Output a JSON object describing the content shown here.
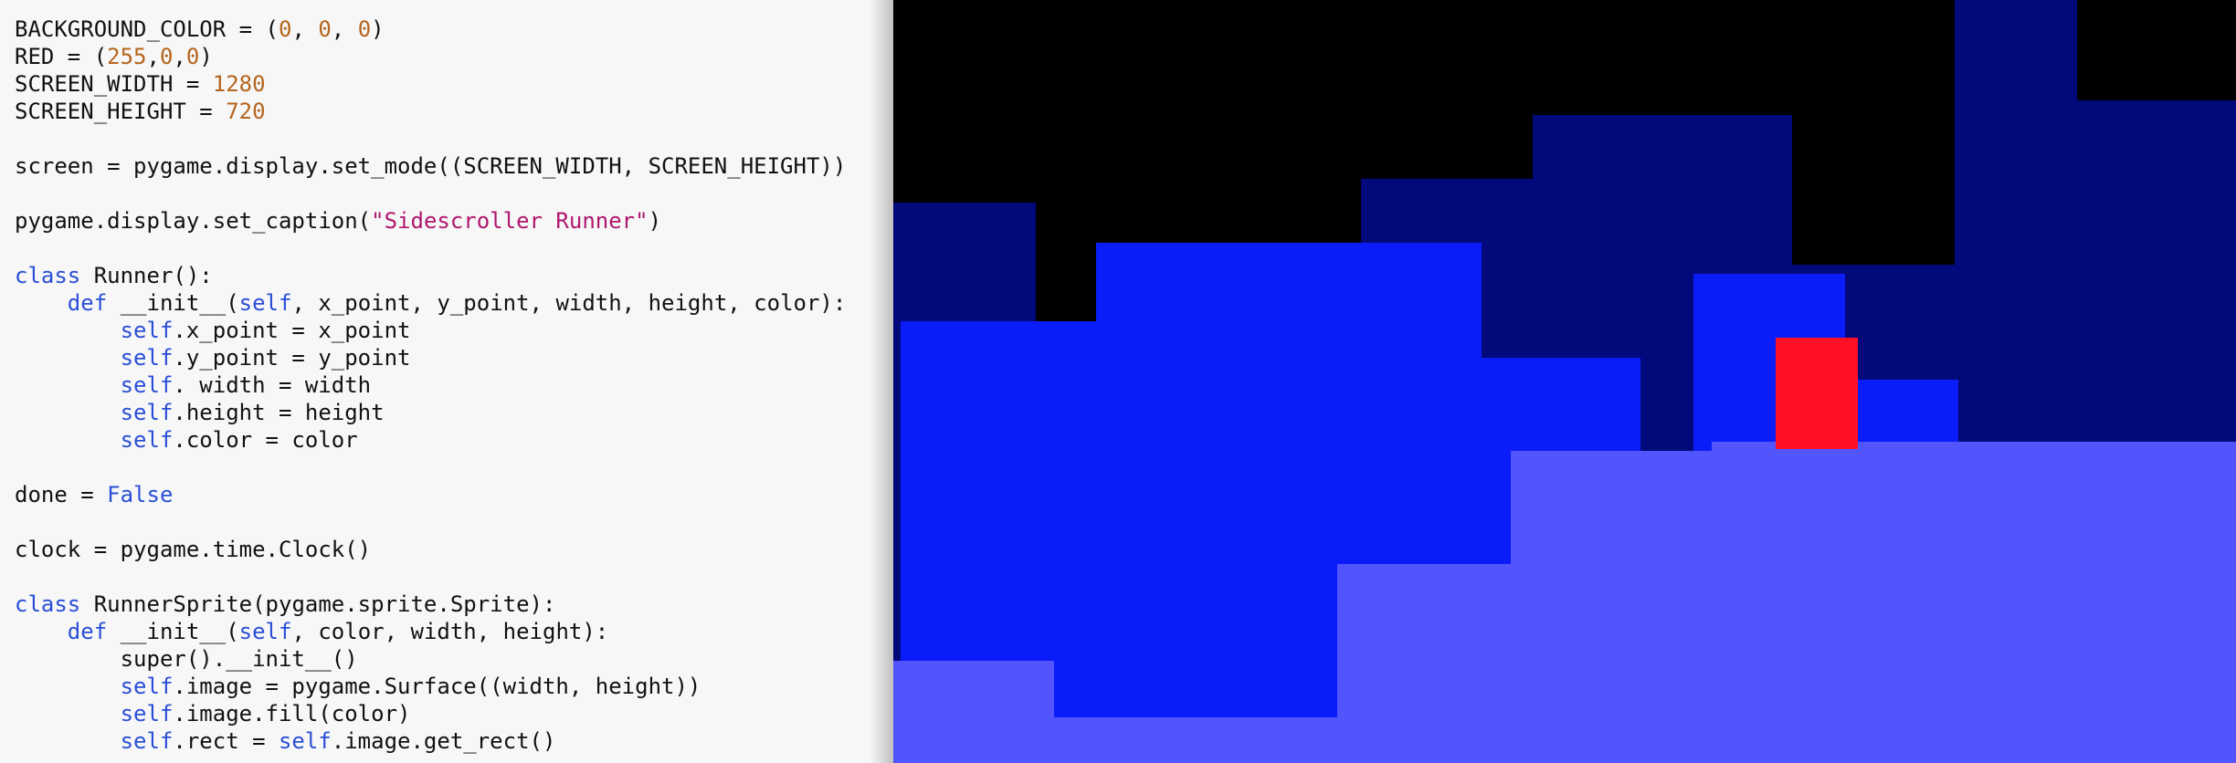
{
  "editor": {
    "lines": [
      [
        {
          "t": "BACKGROUND_COLOR = ("
        },
        {
          "t": "0",
          "c": "num"
        },
        {
          "t": ", "
        },
        {
          "t": "0",
          "c": "num"
        },
        {
          "t": ", "
        },
        {
          "t": "0",
          "c": "num"
        },
        {
          "t": ")"
        }
      ],
      [
        {
          "t": "RED = ("
        },
        {
          "t": "255",
          "c": "num"
        },
        {
          "t": ","
        },
        {
          "t": "0",
          "c": "num"
        },
        {
          "t": ","
        },
        {
          "t": "0",
          "c": "num"
        },
        {
          "t": ")"
        }
      ],
      [
        {
          "t": "SCREEN_WIDTH = "
        },
        {
          "t": "1280",
          "c": "num"
        }
      ],
      [
        {
          "t": "SCREEN_HEIGHT = "
        },
        {
          "t": "720",
          "c": "num"
        }
      ],
      [],
      [
        {
          "t": "screen = pygame.display.set_mode((SCREEN_WIDTH, SCREEN_HEIGHT))"
        }
      ],
      [],
      [
        {
          "t": "pygame.display.set_caption("
        },
        {
          "t": "\"Sidescroller Runner\"",
          "c": "str"
        },
        {
          "t": ")"
        }
      ],
      [],
      [
        {
          "t": "class",
          "c": "kw"
        },
        {
          "t": " Runner():"
        }
      ],
      [
        {
          "t": "    "
        },
        {
          "t": "def",
          "c": "kw"
        },
        {
          "t": " __init__("
        },
        {
          "t": "self",
          "c": "kw"
        },
        {
          "t": ", x_point, y_point, width, height, color):"
        }
      ],
      [
        {
          "t": "        "
        },
        {
          "t": "self",
          "c": "kw"
        },
        {
          "t": ".x_point = x_point"
        }
      ],
      [
        {
          "t": "        "
        },
        {
          "t": "self",
          "c": "kw"
        },
        {
          "t": ".y_point = y_point"
        }
      ],
      [
        {
          "t": "        "
        },
        {
          "t": "self",
          "c": "kw"
        },
        {
          "t": ". width = width"
        }
      ],
      [
        {
          "t": "        "
        },
        {
          "t": "self",
          "c": "kw"
        },
        {
          "t": ".height = height"
        }
      ],
      [
        {
          "t": "        "
        },
        {
          "t": "self",
          "c": "kw"
        },
        {
          "t": ".color = color"
        }
      ],
      [],
      [
        {
          "t": "done = "
        },
        {
          "t": "False",
          "c": "kw"
        }
      ],
      [],
      [
        {
          "t": "clock = pygame.time.Clock()"
        }
      ],
      [],
      [
        {
          "t": "class",
          "c": "kw"
        },
        {
          "t": " RunnerSprite(pygame.sprite.Sprite):"
        }
      ],
      [
        {
          "t": "    "
        },
        {
          "t": "def",
          "c": "kw"
        },
        {
          "t": " __init__("
        },
        {
          "t": "self",
          "c": "kw"
        },
        {
          "t": ", color, width, height):"
        }
      ],
      [
        {
          "t": "        super().__init__()"
        }
      ],
      [
        {
          "t": "        "
        },
        {
          "t": "self",
          "c": "kw"
        },
        {
          "t": ".image = pygame.Surface((width, height))"
        }
      ],
      [
        {
          "t": "        "
        },
        {
          "t": "self",
          "c": "kw"
        },
        {
          "t": ".image.fill(color)"
        }
      ],
      [
        {
          "t": "        "
        },
        {
          "t": "self",
          "c": "kw"
        },
        {
          "t": ".rect = "
        },
        {
          "t": "self",
          "c": "kw"
        },
        {
          "t": ".image.get_rect()"
        }
      ]
    ]
  },
  "game": {
    "background_color": "#000000",
    "layer_colors": {
      "far": "#01097b",
      "mid": "#0a1cf8",
      "near": "#5155fb"
    },
    "runner_color": "#ff1024"
  }
}
